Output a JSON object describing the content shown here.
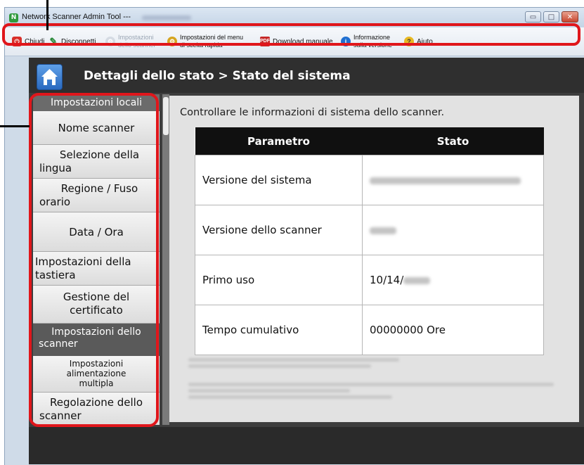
{
  "window": {
    "title": "Network Scanner Admin Tool ---",
    "minimize_glyph": "▭",
    "maximize_glyph": "□",
    "close_glyph": "✕"
  },
  "toolbar": {
    "items": [
      {
        "label": "Chiudi",
        "icon": "close-power-icon",
        "color": "#d9302a"
      },
      {
        "label": "Disconnetti",
        "icon": "disconnect-icon",
        "color": "#2b8a3a"
      },
      {
        "label_line1": "Impostazioni",
        "label_line2": "dello scanner",
        "icon": "gear-icon",
        "disabled": true
      },
      {
        "label_line1": "Impostazioni del menu",
        "label_line2": "di scelta rapida",
        "icon": "gear-icon",
        "color": "#d6a520"
      },
      {
        "label": "Download manuale",
        "icon": "pdf-download-icon",
        "color": "#c62828"
      },
      {
        "label_line1": "Informazione",
        "label_line2": "sulla versione",
        "icon": "info-icon",
        "color": "#1f6fd1"
      },
      {
        "label": "Aiuto",
        "icon": "help-icon",
        "color": "#e8b923"
      }
    ]
  },
  "header": {
    "title": "Dettagli dello stato > Stato del sistema"
  },
  "sidebar": {
    "items": [
      {
        "label": "Impostazioni locali"
      },
      {
        "label": "Nome scanner"
      },
      {
        "label_line1": "Selezione della",
        "label_line2": "lingua"
      },
      {
        "label_line1": "Regione / Fuso",
        "label_line2": "orario"
      },
      {
        "label": "Data / Ora"
      },
      {
        "label_line1": "Impostazioni della",
        "label_line2": "tastiera"
      },
      {
        "label_line1": "Gestione del",
        "label_line2": "certificato"
      },
      {
        "label_line1": "Impostazioni dello",
        "label_line2": "scanner"
      },
      {
        "label_line1": "Impostazioni",
        "label_line2": "alimentazione",
        "label_line3": "multipla"
      },
      {
        "label_line1": "Regolazione dello",
        "label_line2": "scanner"
      }
    ]
  },
  "content": {
    "intro": "Controllare le informazioni di sistema dello scanner.",
    "table": {
      "headers": [
        "Parametro",
        "Stato"
      ],
      "rows": [
        {
          "param": "Versione del sistema",
          "value": ""
        },
        {
          "param": "Versione dello scanner",
          "value": ""
        },
        {
          "param": "Primo uso",
          "value": "10/14/"
        },
        {
          "param": "Tempo cumulativo",
          "value": "00000000 Ore"
        }
      ]
    }
  },
  "colors": {
    "highlight": "#e0161b",
    "header_bg": "#2f2f2f",
    "table_header": "#101010"
  }
}
